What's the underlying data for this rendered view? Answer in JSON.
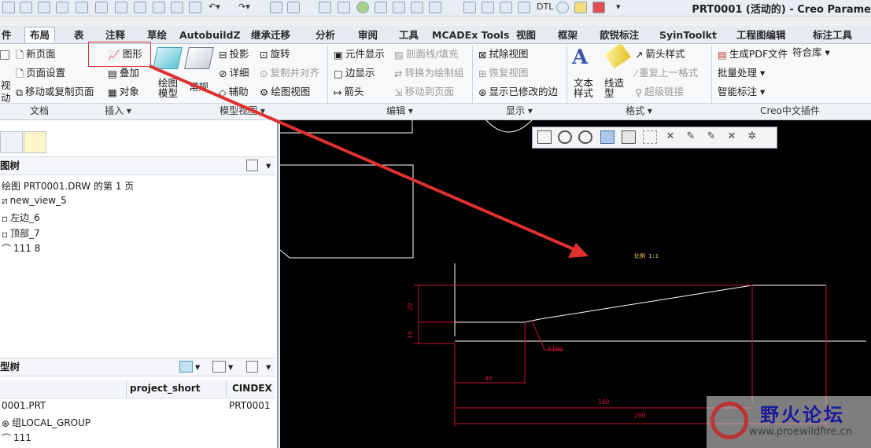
{
  "app": {
    "title": "PRT0001 (活动的) - Creo Parame"
  },
  "qat": {
    "dtl_label": "DTL"
  },
  "tabs": [
    "布局",
    "表",
    "注释",
    "草绘",
    "AutobuildZ",
    "继承迁移",
    "分析",
    "审阅",
    "工具",
    "MCADEx Tools",
    "视图",
    "框架",
    "歆锐标注",
    "SyinToolkt",
    "工程图编辑",
    "标注工具"
  ],
  "tab_partial": "件",
  "ribbon": {
    "document": {
      "label": "文档",
      "items": [
        "新页面",
        "页面设置",
        "移动或复制页面"
      ],
      "big_partial": [
        "视",
        "动"
      ]
    },
    "insert": {
      "label": "插入",
      "items": [
        "图形",
        "叠加",
        "对象"
      ]
    },
    "model_views": {
      "label": "模型视图",
      "big": [
        "绘图\n模型",
        "常规"
      ],
      "items": [
        "投影",
        "旋转",
        "详细",
        "复制并对齐",
        "辅助",
        "绘图视图"
      ]
    },
    "edit": {
      "label": "编辑",
      "items": [
        "元件显示",
        "剖面线/填充",
        "边显示",
        "转换为绘制组",
        "箭头",
        "移动到页面"
      ]
    },
    "display": {
      "label": "显示",
      "items": [
        "拭除视图",
        "恢复视图",
        "显示已修改的边"
      ]
    },
    "format": {
      "label": "格式",
      "big": [
        "文本\n样式",
        "线造\n型"
      ],
      "items": [
        "箭头样式",
        "重复上一格式",
        "超级链接"
      ]
    },
    "plugin": {
      "label": "Creo中文插件",
      "items": [
        "生成PDF文件",
        "符合库",
        "批量处理",
        "智能标注"
      ]
    }
  },
  "left_panel": {
    "drawing_tree": {
      "header": "图树",
      "root": "绘图 PRT0001.DRW 的第 1 页",
      "items": [
        "new_view_5",
        "左边_6",
        "顶部_7",
        "111 8"
      ]
    },
    "model_tree": {
      "header": "型树",
      "col_project": "project_short",
      "col_cindex": "CINDEX",
      "rows": [
        {
          "name": "0001.PRT",
          "cindex": "PRT0001"
        },
        {
          "name": "组LOCAL_GROUP",
          "cindex": ""
        },
        {
          "name": "111",
          "cindex": ""
        }
      ]
    }
  },
  "canvas": {
    "dims": [
      "40",
      "160",
      "200",
      "R100"
    ],
    "small_label": "比例 1:1",
    "vertical_dims": [
      "20",
      "10"
    ]
  },
  "watermark": {
    "title": "野火论坛",
    "url": "www.proewildfire.cn"
  },
  "colors": {
    "annotation": "#e03030",
    "canvas_bg": "#000000",
    "dim_line": "#c8102e",
    "geometry": "#ffffff"
  }
}
